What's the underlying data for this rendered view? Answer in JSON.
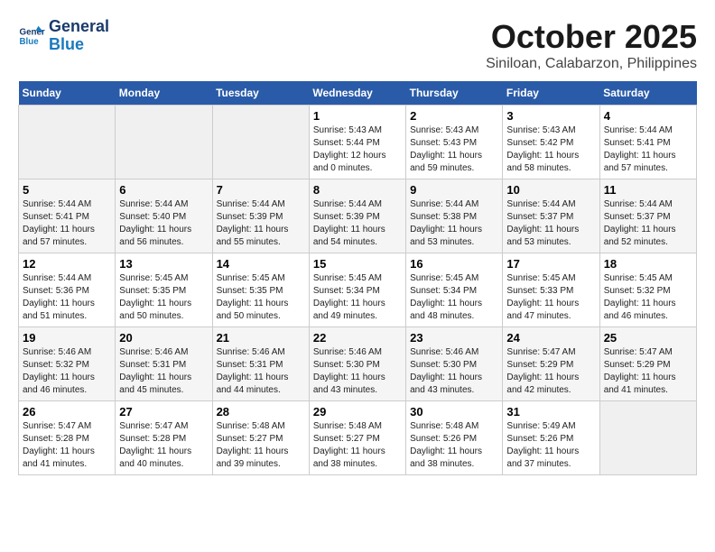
{
  "header": {
    "logo_line1": "General",
    "logo_line2": "Blue",
    "month": "October 2025",
    "location": "Siniloan, Calabarzon, Philippines"
  },
  "weekdays": [
    "Sunday",
    "Monday",
    "Tuesday",
    "Wednesday",
    "Thursday",
    "Friday",
    "Saturday"
  ],
  "weeks": [
    [
      {
        "day": "",
        "empty": true
      },
      {
        "day": "",
        "empty": true
      },
      {
        "day": "",
        "empty": true
      },
      {
        "day": "1",
        "sunrise": "5:43 AM",
        "sunset": "5:44 PM",
        "daylight": "12 hours and 0 minutes."
      },
      {
        "day": "2",
        "sunrise": "5:43 AM",
        "sunset": "5:43 PM",
        "daylight": "11 hours and 59 minutes."
      },
      {
        "day": "3",
        "sunrise": "5:43 AM",
        "sunset": "5:42 PM",
        "daylight": "11 hours and 58 minutes."
      },
      {
        "day": "4",
        "sunrise": "5:44 AM",
        "sunset": "5:41 PM",
        "daylight": "11 hours and 57 minutes."
      }
    ],
    [
      {
        "day": "5",
        "sunrise": "5:44 AM",
        "sunset": "5:41 PM",
        "daylight": "11 hours and 57 minutes."
      },
      {
        "day": "6",
        "sunrise": "5:44 AM",
        "sunset": "5:40 PM",
        "daylight": "11 hours and 56 minutes."
      },
      {
        "day": "7",
        "sunrise": "5:44 AM",
        "sunset": "5:39 PM",
        "daylight": "11 hours and 55 minutes."
      },
      {
        "day": "8",
        "sunrise": "5:44 AM",
        "sunset": "5:39 PM",
        "daylight": "11 hours and 54 minutes."
      },
      {
        "day": "9",
        "sunrise": "5:44 AM",
        "sunset": "5:38 PM",
        "daylight": "11 hours and 53 minutes."
      },
      {
        "day": "10",
        "sunrise": "5:44 AM",
        "sunset": "5:37 PM",
        "daylight": "11 hours and 53 minutes."
      },
      {
        "day": "11",
        "sunrise": "5:44 AM",
        "sunset": "5:37 PM",
        "daylight": "11 hours and 52 minutes."
      }
    ],
    [
      {
        "day": "12",
        "sunrise": "5:44 AM",
        "sunset": "5:36 PM",
        "daylight": "11 hours and 51 minutes."
      },
      {
        "day": "13",
        "sunrise": "5:45 AM",
        "sunset": "5:35 PM",
        "daylight": "11 hours and 50 minutes."
      },
      {
        "day": "14",
        "sunrise": "5:45 AM",
        "sunset": "5:35 PM",
        "daylight": "11 hours and 50 minutes."
      },
      {
        "day": "15",
        "sunrise": "5:45 AM",
        "sunset": "5:34 PM",
        "daylight": "11 hours and 49 minutes."
      },
      {
        "day": "16",
        "sunrise": "5:45 AM",
        "sunset": "5:34 PM",
        "daylight": "11 hours and 48 minutes."
      },
      {
        "day": "17",
        "sunrise": "5:45 AM",
        "sunset": "5:33 PM",
        "daylight": "11 hours and 47 minutes."
      },
      {
        "day": "18",
        "sunrise": "5:45 AM",
        "sunset": "5:32 PM",
        "daylight": "11 hours and 46 minutes."
      }
    ],
    [
      {
        "day": "19",
        "sunrise": "5:46 AM",
        "sunset": "5:32 PM",
        "daylight": "11 hours and 46 minutes."
      },
      {
        "day": "20",
        "sunrise": "5:46 AM",
        "sunset": "5:31 PM",
        "daylight": "11 hours and 45 minutes."
      },
      {
        "day": "21",
        "sunrise": "5:46 AM",
        "sunset": "5:31 PM",
        "daylight": "11 hours and 44 minutes."
      },
      {
        "day": "22",
        "sunrise": "5:46 AM",
        "sunset": "5:30 PM",
        "daylight": "11 hours and 43 minutes."
      },
      {
        "day": "23",
        "sunrise": "5:46 AM",
        "sunset": "5:30 PM",
        "daylight": "11 hours and 43 minutes."
      },
      {
        "day": "24",
        "sunrise": "5:47 AM",
        "sunset": "5:29 PM",
        "daylight": "11 hours and 42 minutes."
      },
      {
        "day": "25",
        "sunrise": "5:47 AM",
        "sunset": "5:29 PM",
        "daylight": "11 hours and 41 minutes."
      }
    ],
    [
      {
        "day": "26",
        "sunrise": "5:47 AM",
        "sunset": "5:28 PM",
        "daylight": "11 hours and 41 minutes."
      },
      {
        "day": "27",
        "sunrise": "5:47 AM",
        "sunset": "5:28 PM",
        "daylight": "11 hours and 40 minutes."
      },
      {
        "day": "28",
        "sunrise": "5:48 AM",
        "sunset": "5:27 PM",
        "daylight": "11 hours and 39 minutes."
      },
      {
        "day": "29",
        "sunrise": "5:48 AM",
        "sunset": "5:27 PM",
        "daylight": "11 hours and 38 minutes."
      },
      {
        "day": "30",
        "sunrise": "5:48 AM",
        "sunset": "5:26 PM",
        "daylight": "11 hours and 38 minutes."
      },
      {
        "day": "31",
        "sunrise": "5:49 AM",
        "sunset": "5:26 PM",
        "daylight": "11 hours and 37 minutes."
      },
      {
        "day": "",
        "empty": true
      }
    ]
  ],
  "labels": {
    "sunrise": "Sunrise:",
    "sunset": "Sunset:",
    "daylight": "Daylight:"
  }
}
